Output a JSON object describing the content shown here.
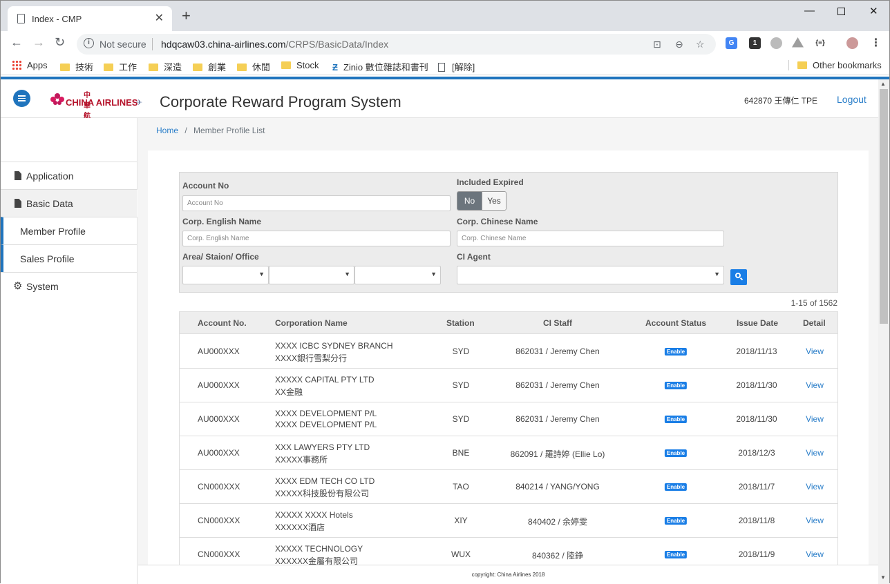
{
  "browser": {
    "tab_title": "Index - CMP",
    "new_tab": "+",
    "not_secure": "Not secure",
    "url_host": "hdqcaw03.china-airlines.com",
    "url_path": "/CRPS/BasicData/Index",
    "bookmarks": [
      "Apps",
      "技術",
      "工作",
      "深造",
      "創業",
      "休閒",
      "Stock",
      "Zinio 數位雜誌和書刊",
      "[解除]"
    ],
    "other_bookmarks": "Other bookmarks",
    "ext_badge": "1",
    "ext_json": "{≡}"
  },
  "header": {
    "logo_zh": "中華航空",
    "logo_en": "CHINA AIRLINES",
    "app_title": "Corporate Reward Program System",
    "user": "642870 王傳仁 TPE",
    "logout": "Logout"
  },
  "sidebar": {
    "items": [
      {
        "label": "Application"
      },
      {
        "label": "Basic Data"
      },
      {
        "label": "Member Profile"
      },
      {
        "label": "Sales Profile"
      },
      {
        "label": "System"
      }
    ]
  },
  "breadcrumb": {
    "home": "Home",
    "sep": "/",
    "current": "Member Profile List"
  },
  "filter": {
    "account_no_label": "Account No",
    "account_no_placeholder": "Account No",
    "included_expired_label": "Included Expired",
    "toggle_no": "No",
    "toggle_yes": "Yes",
    "eng_name_label": "Corp. English Name",
    "eng_name_placeholder": "Corp. English Name",
    "chn_name_label": "Corp. Chinese Name",
    "chn_name_placeholder": "Corp. Chinese Name",
    "area_label": "Area/ Staion/ Office",
    "agent_label": "CI Agent"
  },
  "pagination": {
    "count": "1-15 of 1562"
  },
  "table": {
    "headers": [
      "Account No.",
      "Corporation Name",
      "Station",
      "CI Staff",
      "Account Status",
      "Issue Date",
      "Detail"
    ],
    "rows": [
      {
        "acct": "AU000XXX",
        "name1": "XXXX ICBC SYDNEY BRANCH",
        "name2": "XXXX銀行雪梨分行",
        "station": "SYD",
        "staff": "862031 / Jeremy Chen",
        "status": "Enable",
        "date": "2018/11/13",
        "detail": "View"
      },
      {
        "acct": "AU000XXX",
        "name1": "XXXXX CAPITAL PTY LTD",
        "name2": "XX金融",
        "station": "SYD",
        "staff": "862031 / Jeremy Chen",
        "status": "Enable",
        "date": "2018/11/30",
        "detail": "View"
      },
      {
        "acct": "AU000XXX",
        "name1": "XXXX DEVELOPMENT P/L",
        "name2": "XXXX DEVELOPMENT P/L",
        "station": "SYD",
        "staff": "862031 / Jeremy Chen",
        "status": "Enable",
        "date": "2018/11/30",
        "detail": "View"
      },
      {
        "acct": "AU000XXX",
        "name1": "XXX LAWYERS PTY LTD",
        "name2": "XXXXX事務所",
        "station": "BNE",
        "staff": "862091 / 羅詩婷 (Ellie Lo)",
        "status": "Enable",
        "date": "2018/12/3",
        "detail": "View"
      },
      {
        "acct": "CN000XXX",
        "name1": "XXXX EDM TECH CO LTD",
        "name2": "XXXXX科技股份有限公司",
        "station": "TAO",
        "staff": "840214 / YANG/YONG",
        "status": "Enable",
        "date": "2018/11/7",
        "detail": "View"
      },
      {
        "acct": "CN000XXX",
        "name1": "XXXXX XXXX Hotels",
        "name2": "XXXXXX酒店",
        "station": "XIY",
        "staff": "840402 / 余婷雯",
        "status": "Enable",
        "date": "2018/11/8",
        "detail": "View"
      },
      {
        "acct": "CN000XXX",
        "name1": "XXXXX TECHNOLOGY",
        "name2": "XXXXXX金屬有限公司",
        "station": "WUX",
        "staff": "840362 / 陸錚",
        "status": "Enable",
        "date": "2018/11/9",
        "detail": "View"
      }
    ]
  },
  "footer": {
    "text": "copyright: China Airlines 2018"
  },
  "colors": {
    "accent": "#1f74bd",
    "badge": "#1a7ee6",
    "link": "#2a7ec9"
  }
}
